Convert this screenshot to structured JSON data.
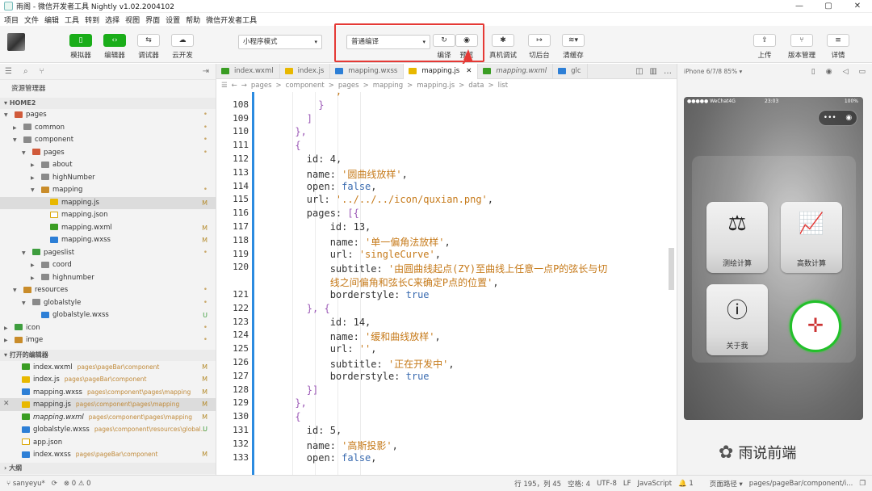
{
  "titlebar": {
    "title": "雨阁 - 微信开发者工具 Nightly v1.02.2004102",
    "min": "—",
    "max": "▢",
    "close": "✕"
  },
  "menu": [
    "项目",
    "文件",
    "编辑",
    "工具",
    "转到",
    "选择",
    "视图",
    "界面",
    "设置",
    "帮助",
    "微信开发者工具"
  ],
  "toolbar": {
    "simulator": "模拟器",
    "editor": "编辑器",
    "debugger": "调试器",
    "cloud": "云开发",
    "mode_select": "小程序模式",
    "compile_select": "普通编译",
    "compile": "编译",
    "preview": "预览",
    "real_debug": "真机调试",
    "bg": "切后台",
    "clear_cache": "清缓存",
    "upload": "上传",
    "version": "版本管理",
    "detail": "详情"
  },
  "sidebar": {
    "panel_title": "资源管理器",
    "project": "HOME2",
    "tree": [
      {
        "name": "pages",
        "depth": 0,
        "kind": "fold r",
        "open": true,
        "mark": "•",
        "mk": "dot"
      },
      {
        "name": "common",
        "depth": 1,
        "kind": "fold",
        "open": false,
        "mark": "•",
        "mk": "dot"
      },
      {
        "name": "component",
        "depth": 1,
        "kind": "fold",
        "open": true,
        "mark": "•",
        "mk": "dot"
      },
      {
        "name": "pages",
        "depth": 2,
        "kind": "fold r",
        "open": true,
        "mark": "•",
        "mk": "dot"
      },
      {
        "name": "about",
        "depth": 3,
        "kind": "fold",
        "open": false,
        "mark": "",
        "mk": ""
      },
      {
        "name": "highNumber",
        "depth": 3,
        "kind": "fold",
        "open": false,
        "mark": "",
        "mk": ""
      },
      {
        "name": "mapping",
        "depth": 3,
        "kind": "fold o",
        "open": true,
        "mark": "•",
        "mk": "dot"
      },
      {
        "name": "mapping.js",
        "depth": 4,
        "kind": "jsic",
        "open": null,
        "mark": "M",
        "mk": "M",
        "sel": true
      },
      {
        "name": "mapping.json",
        "depth": 4,
        "kind": "jsonic",
        "open": null,
        "mark": "",
        "mk": ""
      },
      {
        "name": "mapping.wxml",
        "depth": 4,
        "kind": "wxic",
        "open": null,
        "mark": "M",
        "mk": "M"
      },
      {
        "name": "mapping.wxss",
        "depth": 4,
        "kind": "wssic",
        "open": null,
        "mark": "M",
        "mk": "M"
      },
      {
        "name": "pageslist",
        "depth": 2,
        "kind": "fold g",
        "open": true,
        "mark": "•",
        "mk": "dot"
      },
      {
        "name": "coord",
        "depth": 3,
        "kind": "fold",
        "open": false,
        "mark": "",
        "mk": ""
      },
      {
        "name": "highnumber",
        "depth": 3,
        "kind": "fold",
        "open": false,
        "mark": "",
        "mk": ""
      },
      {
        "name": "resources",
        "depth": 1,
        "kind": "fold o",
        "open": true,
        "mark": "•",
        "mk": "dot"
      },
      {
        "name": "globalstyle",
        "depth": 2,
        "kind": "fold",
        "open": true,
        "mark": "•",
        "mk": "dot"
      },
      {
        "name": "globalstyle.wxss",
        "depth": 3,
        "kind": "wssic",
        "open": null,
        "mark": "U",
        "mk": "U"
      },
      {
        "name": "icon",
        "depth": 0,
        "kind": "fold g",
        "open": false,
        "mark": "•",
        "mk": "dot"
      },
      {
        "name": "imge",
        "depth": 0,
        "kind": "fold o",
        "open": false,
        "mark": "•",
        "mk": "dot"
      }
    ],
    "open_editors_title": "打开的编辑器",
    "open_editors": [
      {
        "name": "index.wxml",
        "path": "pages\\pageBar\\component",
        "kind": "wxic",
        "mark": "M",
        "it": false,
        "x": false
      },
      {
        "name": "index.js",
        "path": "pages\\pageBar\\component",
        "kind": "jsic",
        "mark": "M",
        "it": false,
        "x": false
      },
      {
        "name": "mapping.wxss",
        "path": "pages\\component\\pages\\mapping",
        "kind": "wssic",
        "mark": "M",
        "it": false,
        "x": false
      },
      {
        "name": "mapping.js",
        "path": "pages\\component\\pages\\mapping",
        "kind": "jsic",
        "mark": "M",
        "it": false,
        "x": true
      },
      {
        "name": "mapping.wxml",
        "path": "pages\\component\\pages\\mapping",
        "kind": "wxic",
        "mark": "M",
        "it": true,
        "x": false
      },
      {
        "name": "globalstyle.wxss",
        "path": "pages\\component\\resources\\global...",
        "kind": "wssic",
        "mark": "U",
        "it": false,
        "x": false
      },
      {
        "name": "app.json",
        "path": "",
        "kind": "jsonic",
        "mark": "",
        "it": false,
        "x": false
      },
      {
        "name": "index.wxss",
        "path": "pages\\pageBar\\component",
        "kind": "wssic",
        "mark": "M",
        "it": false,
        "x": false
      }
    ],
    "outline_title": "大纲"
  },
  "tabs": [
    {
      "name": "index.wxml",
      "kind": "wxic",
      "active": false,
      "it": false
    },
    {
      "name": "index.js",
      "kind": "jsic",
      "active": false,
      "it": false
    },
    {
      "name": "mapping.wxss",
      "kind": "wssic",
      "active": false,
      "it": false
    },
    {
      "name": "mapping.js",
      "kind": "jsic",
      "active": true,
      "it": false
    },
    {
      "name": "mapping.wxml",
      "kind": "wxic",
      "active": false,
      "it": true
    },
    {
      "name": "glc",
      "kind": "wssic",
      "active": false,
      "it": false
    }
  ],
  "breadcrumb": [
    "pages",
    ">",
    "component",
    ">",
    "pages",
    ">",
    "mapping",
    ">",
    "mapping.js",
    ">",
    "data",
    ">",
    "list"
  ],
  "code": [
    {
      "n": "",
      "t": [
        [
          "            ','",
          "str"
        ]
      ]
    },
    {
      "n": "108",
      "t": [
        [
          "          }",
          "br"
        ]
      ]
    },
    {
      "n": "109",
      "t": [
        [
          "        ]",
          "br"
        ]
      ]
    },
    {
      "n": "110",
      "t": [
        [
          "      },",
          "br"
        ]
      ]
    },
    {
      "n": "111",
      "t": [
        [
          "      {",
          "br"
        ]
      ]
    },
    {
      "n": "112",
      "t": [
        [
          "        id: ",
          "key"
        ],
        [
          "4",
          "num"
        ],
        [
          ",",
          "key"
        ]
      ]
    },
    {
      "n": "113",
      "t": [
        [
          "        name: ",
          "key"
        ],
        [
          "'圆曲线放样'",
          "str"
        ],
        [
          ",",
          "key"
        ]
      ]
    },
    {
      "n": "114",
      "t": [
        [
          "        open: ",
          "key"
        ],
        [
          "false",
          "kw"
        ],
        [
          ",",
          "key"
        ]
      ]
    },
    {
      "n": "115",
      "t": [
        [
          "        url: ",
          "key"
        ],
        [
          "'../../../icon/quxian.png'",
          "str"
        ],
        [
          ",",
          "key"
        ]
      ]
    },
    {
      "n": "116",
      "t": [
        [
          "        pages: ",
          "key"
        ],
        [
          "[{",
          "br"
        ]
      ]
    },
    {
      "n": "117",
      "t": [
        [
          "            id: ",
          "key"
        ],
        [
          "13",
          "num"
        ],
        [
          ",",
          "key"
        ]
      ]
    },
    {
      "n": "118",
      "t": [
        [
          "            name: ",
          "key"
        ],
        [
          "'单一偏角法放样'",
          "str"
        ],
        [
          ",",
          "key"
        ]
      ]
    },
    {
      "n": "119",
      "t": [
        [
          "            url: ",
          "key"
        ],
        [
          "'singleCurve'",
          "str"
        ],
        [
          ",",
          "key"
        ]
      ]
    },
    {
      "n": "120",
      "t": [
        [
          "            subtitle: ",
          "key"
        ],
        [
          "'由圆曲线起点(ZY)至曲线上任意一点P的弦长与切",
          "str"
        ]
      ]
    },
    {
      "n": "",
      "t": [
        [
          "            线之间偏角和弦长C来确定P点的位置'",
          "str"
        ],
        [
          ",",
          "key"
        ]
      ]
    },
    {
      "n": "121",
      "t": [
        [
          "            borderstyle: ",
          "key"
        ],
        [
          "true",
          "kw"
        ]
      ]
    },
    {
      "n": "122",
      "t": [
        [
          "        }, {",
          "br"
        ]
      ]
    },
    {
      "n": "123",
      "t": [
        [
          "            id: ",
          "key"
        ],
        [
          "14",
          "num"
        ],
        [
          ",",
          "key"
        ]
      ]
    },
    {
      "n": "124",
      "t": [
        [
          "            name: ",
          "key"
        ],
        [
          "'缓和曲线放样'",
          "str"
        ],
        [
          ",",
          "key"
        ]
      ]
    },
    {
      "n": "125",
      "t": [
        [
          "            url: ",
          "key"
        ],
        [
          "''",
          "str"
        ],
        [
          ",",
          "key"
        ]
      ]
    },
    {
      "n": "126",
      "t": [
        [
          "            subtitle: ",
          "key"
        ],
        [
          "'正在开发中'",
          "str"
        ],
        [
          ",",
          "key"
        ]
      ]
    },
    {
      "n": "127",
      "t": [
        [
          "            borderstyle: ",
          "key"
        ],
        [
          "true",
          "kw"
        ]
      ]
    },
    {
      "n": "128",
      "t": [
        [
          "        }]",
          "br"
        ]
      ]
    },
    {
      "n": "129",
      "t": [
        [
          "      },",
          "br"
        ]
      ]
    },
    {
      "n": "130",
      "t": [
        [
          "      {",
          "br"
        ]
      ]
    },
    {
      "n": "131",
      "t": [
        [
          "        id: ",
          "key"
        ],
        [
          "5",
          "num"
        ],
        [
          ",",
          "key"
        ]
      ]
    },
    {
      "n": "132",
      "t": [
        [
          "        name: ",
          "key"
        ],
        [
          "'高斯投影'",
          "str"
        ],
        [
          ",",
          "key"
        ]
      ]
    },
    {
      "n": "133",
      "t": [
        [
          "        open: ",
          "key"
        ],
        [
          "false",
          "kw"
        ],
        [
          ",",
          "key"
        ]
      ]
    }
  ],
  "simulator": {
    "device": "iPhone 6/7/8 85% ▾",
    "status_left": "●●●●● WeChat4G",
    "status_time": "23:03",
    "status_right": "100%",
    "capsule_dots": "•••",
    "capsule_circle": "◉",
    "tiles": [
      {
        "label": "测绘计算",
        "glyph": "⚖"
      },
      {
        "label": "高数计算",
        "glyph": "📈"
      },
      {
        "label": "关于我",
        "glyph": "ⓘ"
      }
    ],
    "compass_glyph": "✛"
  },
  "watermark": "雨说前端",
  "statusbar": {
    "user": "sanyeyu*",
    "sync": "⟳",
    "errors": "⊗ 0 ⚠ 0",
    "position": "行 195，列 45",
    "spaces": "空格: 4",
    "encoding": "UTF-8",
    "eol": "LF",
    "lang": "JavaScript",
    "bell": "1",
    "page_path_label": "页面路径 ▾",
    "page_path": "pages/pageBar/component/i..."
  },
  "colors": {
    "accent_green": "#1aad19",
    "highlight_red": "#e53935",
    "string": "#c67a1a",
    "keyword": "#3a6bb0",
    "bracket": "#9b58b6"
  }
}
